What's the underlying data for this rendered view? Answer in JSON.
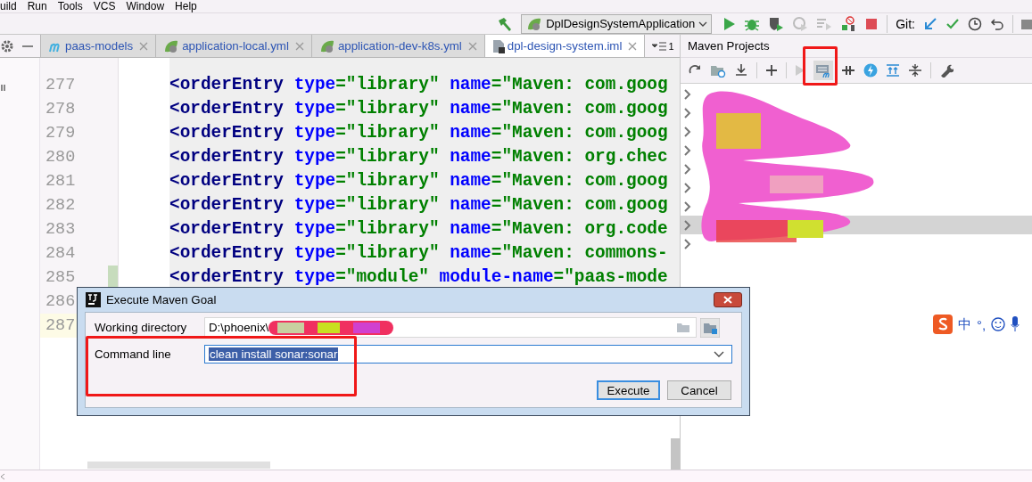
{
  "menu": [
    {
      "label": "uild"
    },
    {
      "label": "Run"
    },
    {
      "label": "Tools"
    },
    {
      "label": "VCS"
    },
    {
      "label": "Window"
    },
    {
      "label": "Help"
    }
  ],
  "toolbar": {
    "run_config": "DplDesignSystemApplication",
    "git_label": "Git:"
  },
  "editor_tabs": [
    {
      "label": "paas-models",
      "kind": "maven",
      "selected": false
    },
    {
      "label": "application-local.yml",
      "kind": "spring",
      "selected": false
    },
    {
      "label": "application-dev-k8s.yml",
      "kind": "spring",
      "selected": false
    },
    {
      "label": "dpl-design-system.iml",
      "kind": "file",
      "selected": true
    }
  ],
  "tab_overflow": "1",
  "editor": {
    "lines": [
      {
        "number": "277",
        "code": "<orderEntry type=\"library\" name=\"Maven: com.goog",
        "changed": false,
        "current": false
      },
      {
        "number": "278",
        "code": "<orderEntry type=\"library\" name=\"Maven: com.goog",
        "changed": false,
        "current": false
      },
      {
        "number": "279",
        "code": "<orderEntry type=\"library\" name=\"Maven: com.goog",
        "changed": false,
        "current": false
      },
      {
        "number": "280",
        "code": "<orderEntry type=\"library\" name=\"Maven: org.chec",
        "changed": false,
        "current": false
      },
      {
        "number": "281",
        "code": "<orderEntry type=\"library\" name=\"Maven: com.goog",
        "changed": false,
        "current": false
      },
      {
        "number": "282",
        "code": "<orderEntry type=\"library\" name=\"Maven: com.goog",
        "changed": false,
        "current": false
      },
      {
        "number": "283",
        "code": "<orderEntry type=\"library\" name=\"Maven: org.code",
        "changed": false,
        "current": false
      },
      {
        "number": "284",
        "code": "<orderEntry type=\"library\" name=\"Maven: commons-",
        "changed": false,
        "current": false
      },
      {
        "number": "285",
        "code": "<orderEntry type=\"module\" module-name=\"paas-mode",
        "changed": true,
        "current": false
      },
      {
        "number": "286",
        "changed": false,
        "current": false
      },
      {
        "number": "287",
        "changed": false,
        "current": true
      }
    ]
  },
  "maven": {
    "title": "Maven Projects",
    "tree_rows": [
      {
        "selected": false
      },
      {
        "selected": false
      },
      {
        "selected": false
      },
      {
        "selected": false
      },
      {
        "selected": false
      },
      {
        "selected": false
      },
      {
        "selected": false
      },
      {
        "selected": true
      },
      {
        "selected": false
      }
    ]
  },
  "dialog": {
    "title": "Execute Maven Goal",
    "fields": [
      {
        "label": "Working directory",
        "value": "D:\\phoenix\\",
        "kind": "path"
      },
      {
        "label": "Command line",
        "value": "clean install sonar:sonar",
        "kind": "combo"
      }
    ],
    "buttons": [
      {
        "label": "Execute",
        "default": true
      },
      {
        "label": "Cancel",
        "default": false
      }
    ]
  },
  "ime": {
    "items": [
      "中",
      "°,"
    ]
  }
}
